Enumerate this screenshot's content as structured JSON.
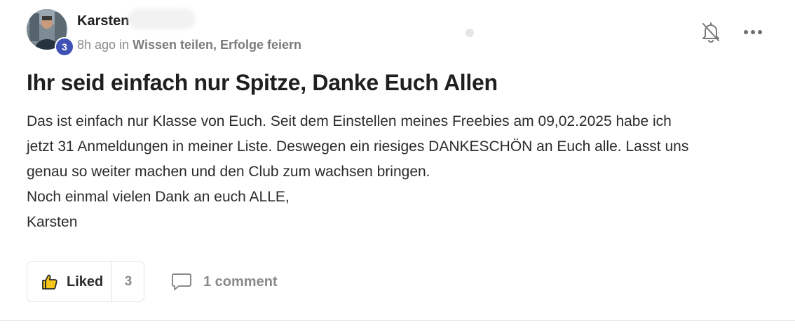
{
  "post": {
    "author": {
      "name": "Karsten",
      "level": "3",
      "avatar_icon": "user-avatar"
    },
    "meta": {
      "time": "8h ago",
      "in_word": "in",
      "group": "Wissen teilen, Erfolge feiern"
    },
    "title": "Ihr seid einfach nur Spitze, Danke Euch Allen",
    "body_lines": [
      "Das ist einfach nur Klasse von Euch. Seit dem Einstellen meines Freebies am 09,02.2025 habe ich",
      "jetzt 31 Anmeldungen in meiner Liste. Deswegen ein riesiges DANKESCHÖN an Euch alle. Lasst uns",
      "genau so weiter machen und den Club zum wachsen bringen.",
      "Noch einmal vielen Dank an euch ALLE,",
      "Karsten"
    ],
    "actions": {
      "notification_icon": "bell-off-icon",
      "more_icon": "more-horizontal-icon"
    },
    "footer": {
      "like_label": "Liked",
      "like_count": "3",
      "comment_label": "1 comment"
    }
  },
  "colors": {
    "badge": "#3f51b5",
    "text_primary": "#202124",
    "text_muted": "#8a8a8a",
    "border": "#e3e3e3",
    "thumb_fill": "#f5c518"
  }
}
